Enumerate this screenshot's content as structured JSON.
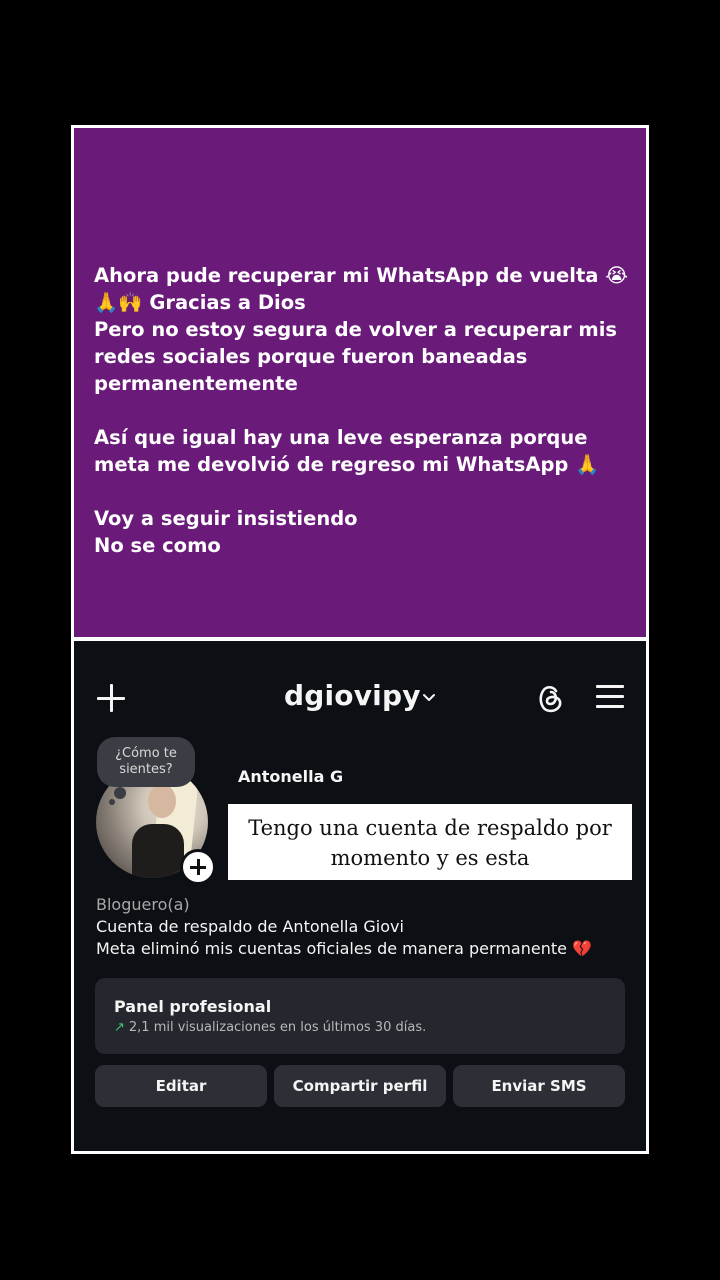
{
  "post": {
    "text": "Ahora pude recuperar mi WhatsApp de vuelta 😭\n🙏🙌 Gracias a Dios\nPero no estoy segura de volver a recuperar mis redes sociales porque fueron baneadas permanentemente\n\nAsí que igual hay una leve esperanza porque meta me devolvió de regreso mi WhatsApp 🙏\n\nVoy a seguir insistiendo\nNo se como"
  },
  "profile": {
    "username": "dgiovipy",
    "note": "¿Cómo te sientes?",
    "display_name": "Antonella G",
    "caption_overlay": "Tengo una cuenta de respaldo por momento y es esta",
    "bio": {
      "category": "Bloguero(a)",
      "line1": "Cuenta de respaldo de Antonella Giovi",
      "line2": "Meta eliminó mis cuentas oficiales de manera permanente 💔"
    },
    "panel": {
      "title": "Panel profesional",
      "arrow": "↗",
      "stat": "2,1 mil visualizaciones en los últimos 30 días."
    },
    "buttons": {
      "edit": "Editar",
      "share": "Compartir perfil",
      "sms": "Enviar SMS"
    }
  },
  "colors": {
    "post_background": "#6a1b7a",
    "profile_background": "#0c0f14",
    "accent_green": "#3ec46b"
  }
}
